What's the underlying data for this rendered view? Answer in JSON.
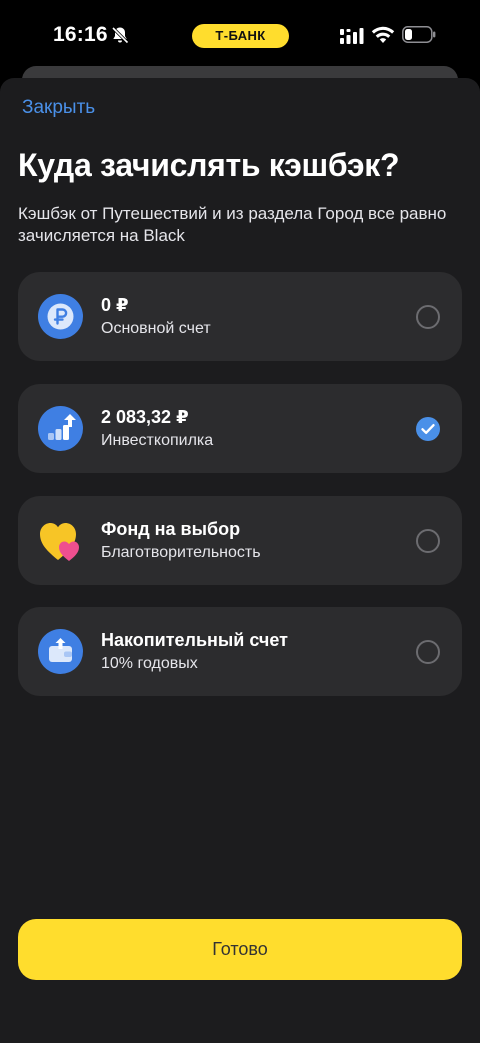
{
  "status_bar": {
    "time": "16:16",
    "brand": "Т-БАНК"
  },
  "header": {
    "close_label": "Закрыть",
    "title": "Куда зачислять кэшбэк?",
    "subtitle": "Кэшбэк от Путешествий и из раздела Город все равно зачисляется на Black"
  },
  "options": [
    {
      "title": "0 ₽",
      "subtitle": "Основной счет",
      "icon": "ruble-coin-icon",
      "selected": false
    },
    {
      "title": "2 083,32 ₽",
      "subtitle": "Инвесткопилка",
      "icon": "invest-growth-icon",
      "selected": true
    },
    {
      "title": "Фонд на выбор",
      "subtitle": "Благотворительность",
      "icon": "hearts-icon",
      "selected": false
    },
    {
      "title": "Накопительный счет",
      "subtitle": "10% годовых",
      "icon": "savings-wallet-icon",
      "selected": false
    }
  ],
  "footer": {
    "done_label": "Готово"
  },
  "colors": {
    "accent_blue": "#4a90e8",
    "brand_yellow": "#ffdd2d",
    "card_bg": "#2c2c2e",
    "sheet_bg": "#1c1c1e"
  }
}
